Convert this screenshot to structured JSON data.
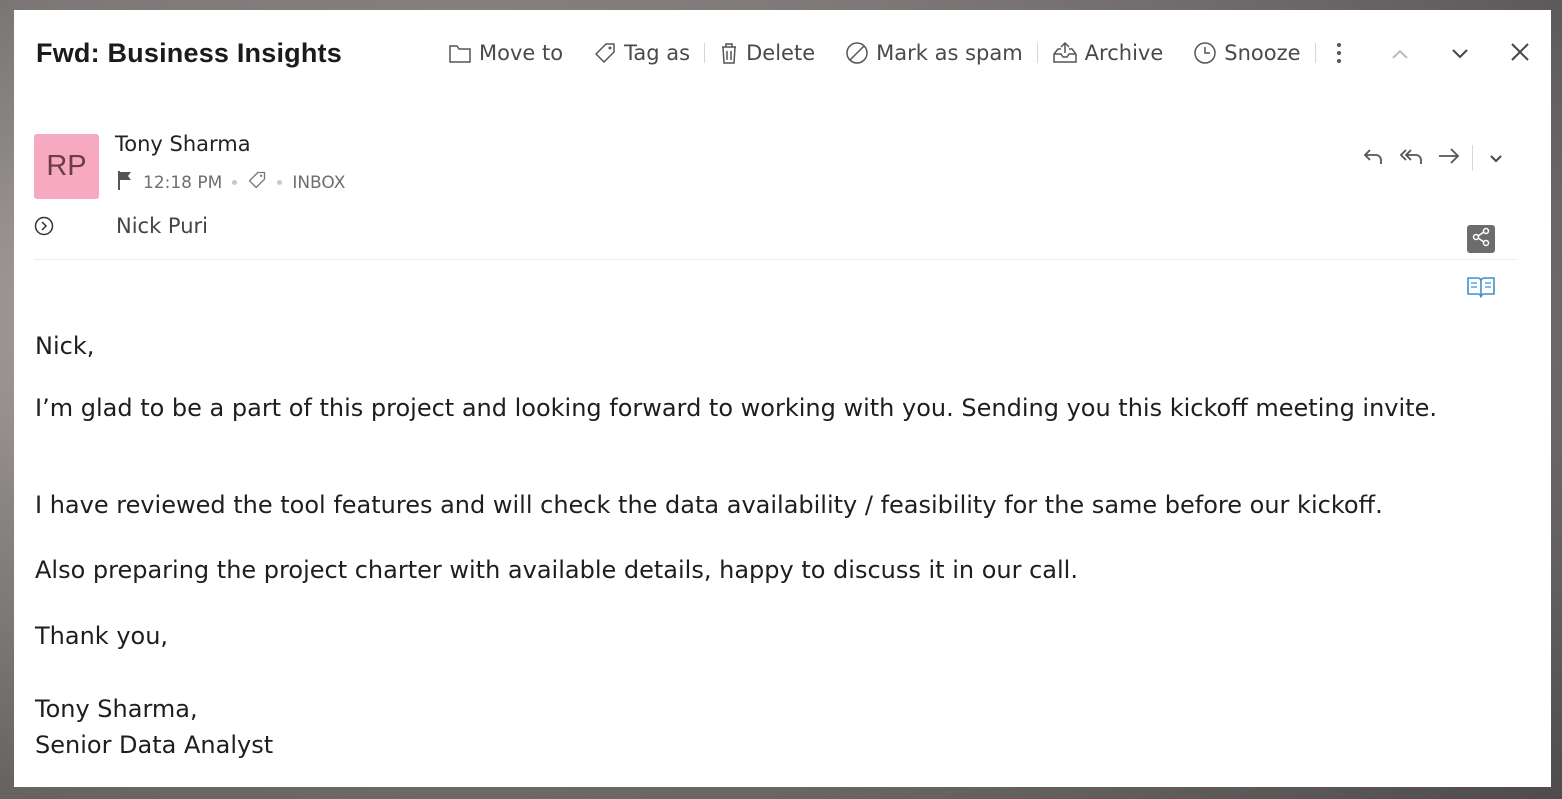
{
  "email": {
    "subject": "Fwd: Business Insights"
  },
  "toolbar": {
    "move_to": "Move to",
    "tag_as": "Tag as",
    "delete": "Delete",
    "mark_as_spam": "Mark as spam",
    "archive": "Archive",
    "snooze": "Snooze"
  },
  "sender": {
    "initials": "RP",
    "avatar_color": "#f6a9c0",
    "name": "Tony Sharma",
    "time": "12:18 PM",
    "folder": "INBOX"
  },
  "recipient": {
    "name": "Nick Puri"
  },
  "body": {
    "greeting": "Nick,",
    "paragraph1": "I’m glad to be a part of this project and looking forward to working with you. Sending you this kickoff meeting invite.",
    "paragraph2": "I have reviewed the tool features and will check the data availability / feasibility for the same before our kickoff.",
    "paragraph3": "Also preparing the project charter with available details, happy to discuss it in our call.",
    "closing": "Thank you,",
    "signature_name": "Tony Sharma,",
    "signature_title": "Senior Data Analyst"
  },
  "colors": {
    "accent_blue": "#3b8fd0",
    "share_bg": "#6c6c6c"
  }
}
